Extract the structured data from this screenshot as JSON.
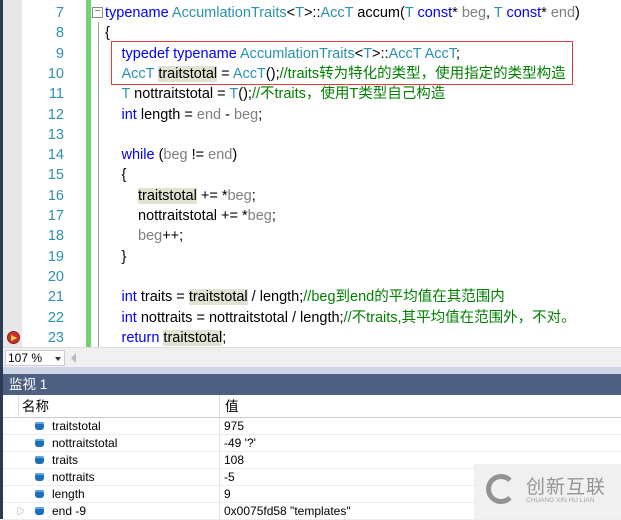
{
  "editor": {
    "lines": [
      {
        "num": "7",
        "indent": 0,
        "tokens": [
          [
            "typename",
            "k"
          ],
          [
            " ",
            "n"
          ],
          [
            "AccumlationTraits",
            "t"
          ],
          [
            "<",
            "n"
          ],
          [
            "T",
            "t"
          ],
          [
            ">::",
            "n"
          ],
          [
            "AccT",
            "t"
          ],
          [
            " accum(",
            "n"
          ],
          [
            "T",
            "t"
          ],
          [
            " ",
            "n"
          ],
          [
            "const",
            "k"
          ],
          [
            "* ",
            "n"
          ],
          [
            "beg",
            "p"
          ],
          [
            ", ",
            "n"
          ],
          [
            "T",
            "t"
          ],
          [
            " ",
            "n"
          ],
          [
            "const",
            "k"
          ],
          [
            "* ",
            "n"
          ],
          [
            "end",
            "p"
          ],
          [
            ")",
            "n"
          ]
        ]
      },
      {
        "num": "8",
        "indent": 0,
        "tokens": [
          [
            "{",
            "n"
          ]
        ]
      },
      {
        "num": "9",
        "indent": 1,
        "tokens": [
          [
            "typedef typename",
            "k"
          ],
          [
            " ",
            "n"
          ],
          [
            "AccumlationTraits",
            "t"
          ],
          [
            "<",
            "n"
          ],
          [
            "T",
            "t"
          ],
          [
            ">::",
            "n"
          ],
          [
            "AccT",
            "t"
          ],
          [
            " ",
            "n"
          ],
          [
            "AccT",
            "t"
          ],
          [
            ";",
            "n"
          ]
        ]
      },
      {
        "num": "10",
        "indent": 1,
        "tokens": [
          [
            "AccT",
            "t"
          ],
          [
            " ",
            "n"
          ],
          [
            "traitstotal",
            "h"
          ],
          [
            " = ",
            "n"
          ],
          [
            "AccT",
            "t"
          ],
          [
            "();",
            "n"
          ],
          [
            "//traits转为特化的类型，使用指定的类型构造",
            "c"
          ]
        ]
      },
      {
        "num": "11",
        "indent": 1,
        "tokens": [
          [
            "T",
            "t"
          ],
          [
            " nottraitstotal = ",
            "n"
          ],
          [
            "T",
            "t"
          ],
          [
            "();",
            "n"
          ],
          [
            "//不traits，使用T类型自己构造",
            "c"
          ]
        ]
      },
      {
        "num": "12",
        "indent": 1,
        "tokens": [
          [
            "int",
            "k"
          ],
          [
            " length = ",
            "n"
          ],
          [
            "end",
            "p"
          ],
          [
            " - ",
            "n"
          ],
          [
            "beg",
            "p"
          ],
          [
            ";",
            "n"
          ]
        ]
      },
      {
        "num": "13",
        "indent": 1,
        "tokens": []
      },
      {
        "num": "14",
        "indent": 1,
        "tokens": [
          [
            "while",
            "k"
          ],
          [
            " (",
            "n"
          ],
          [
            "beg",
            "p"
          ],
          [
            " != ",
            "n"
          ],
          [
            "end",
            "p"
          ],
          [
            ")",
            "n"
          ]
        ]
      },
      {
        "num": "15",
        "indent": 1,
        "tokens": [
          [
            "{",
            "n"
          ]
        ]
      },
      {
        "num": "16",
        "indent": 2,
        "tokens": [
          [
            "traitstotal",
            "h"
          ],
          [
            " += *",
            "n"
          ],
          [
            "beg",
            "p"
          ],
          [
            ";",
            "n"
          ]
        ]
      },
      {
        "num": "17",
        "indent": 2,
        "tokens": [
          [
            "nottraitstotal += *",
            "n"
          ],
          [
            "beg",
            "p"
          ],
          [
            ";",
            "n"
          ]
        ]
      },
      {
        "num": "18",
        "indent": 2,
        "tokens": [
          [
            "beg",
            "p"
          ],
          [
            "++;",
            "n"
          ]
        ]
      },
      {
        "num": "19",
        "indent": 1,
        "tokens": [
          [
            "}",
            "n"
          ]
        ]
      },
      {
        "num": "20",
        "indent": 1,
        "tokens": []
      },
      {
        "num": "21",
        "indent": 1,
        "tokens": [
          [
            "int",
            "k"
          ],
          [
            " traits = ",
            "n"
          ],
          [
            "traitstotal",
            "h"
          ],
          [
            " / length;",
            "n"
          ],
          [
            "//beg到end的平均值在其范围内",
            "c"
          ]
        ]
      },
      {
        "num": "22",
        "indent": 1,
        "tokens": [
          [
            "int",
            "k"
          ],
          [
            " nottraits = nottraitstotal / length;",
            "n"
          ],
          [
            "//不traits,其平均值在范围外，不对。",
            "c"
          ]
        ]
      },
      {
        "num": "23",
        "indent": 1,
        "tokens": [
          [
            "return",
            "k"
          ],
          [
            " ",
            "n"
          ],
          [
            "traitstotal",
            "h"
          ],
          [
            ";",
            "n"
          ]
        ]
      }
    ],
    "fold_glyph": "−"
  },
  "zoom": {
    "value": "107 %"
  },
  "watch": {
    "title": "监视 1",
    "col_name": "名称",
    "col_value": "值",
    "rows": [
      {
        "name": "traitstotal",
        "value": "975",
        "expandable": false
      },
      {
        "name": "nottraitstotal",
        "value": "-49 '?'",
        "expandable": false
      },
      {
        "name": "traits",
        "value": "108",
        "expandable": false
      },
      {
        "name": "nottraits",
        "value": "-5",
        "expandable": false
      },
      {
        "name": "length",
        "value": "9",
        "expandable": false
      },
      {
        "name": "end -9",
        "value": "0x0075fd58 \"templates\"",
        "expandable": true
      }
    ]
  },
  "watermark": {
    "cn": "创新互联",
    "en": "CHUANG XIN HU LIAN",
    "mark": "X"
  },
  "colors": {
    "keyword": "#0000ff",
    "type": "#2b91af",
    "param": "#808080",
    "comment": "#008000",
    "watch_header": "#4d6082",
    "highlight_box": "#e83a3a"
  }
}
